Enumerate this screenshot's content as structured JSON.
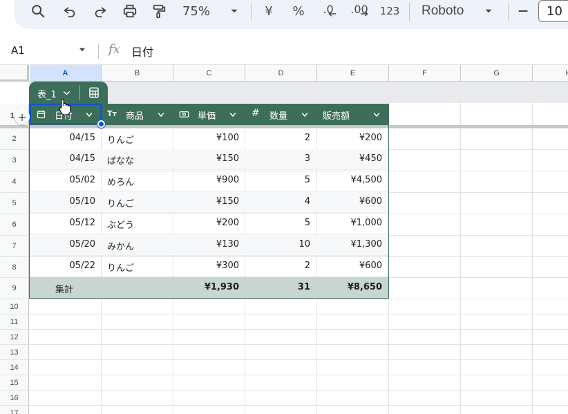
{
  "toolbar": {
    "zoom": "75%",
    "currency_symbol": "¥",
    "percent_symbol": "%",
    "decrease_decimals": ".0",
    "increase_decimals": ".00",
    "number_format": "123",
    "font": "Roboto",
    "font_size": "10",
    "font_size_minus": "—"
  },
  "formula_bar": {
    "cell_ref": "A1",
    "fx": "fx",
    "value": "日付"
  },
  "columns": [
    "A",
    "B",
    "C",
    "D",
    "E",
    "F",
    "G",
    "H"
  ],
  "rows": [
    "1",
    "2",
    "3",
    "4",
    "5",
    "6",
    "7",
    "8",
    "9",
    "10",
    "11",
    "12",
    "13",
    "14",
    "15",
    "16",
    "17"
  ],
  "table": {
    "name": "表_1",
    "headers": [
      "日付",
      "商品",
      "単価",
      "数量",
      "販売額"
    ],
    "data_rows": [
      [
        "04/15",
        "りんご",
        "¥100",
        "2",
        "¥200"
      ],
      [
        "04/15",
        "ばなな",
        "¥150",
        "3",
        "¥450"
      ],
      [
        "05/02",
        "めろん",
        "¥900",
        "5",
        "¥4,500"
      ],
      [
        "05/10",
        "りんご",
        "¥150",
        "4",
        "¥600"
      ],
      [
        "05/12",
        "ぶどう",
        "¥200",
        "5",
        "¥1,000"
      ],
      [
        "05/20",
        "みかん",
        "¥130",
        "10",
        "¥1,300"
      ],
      [
        "05/22",
        "りんご",
        "¥300",
        "2",
        "¥600"
      ]
    ],
    "total": {
      "label": "集計",
      "price": "¥1,930",
      "quantity": "31",
      "sales": "¥8,650"
    }
  },
  "colors": {
    "table_header": "#3c6e5a",
    "total_row": "#c7d6cf",
    "selection": "#0b57d0"
  }
}
